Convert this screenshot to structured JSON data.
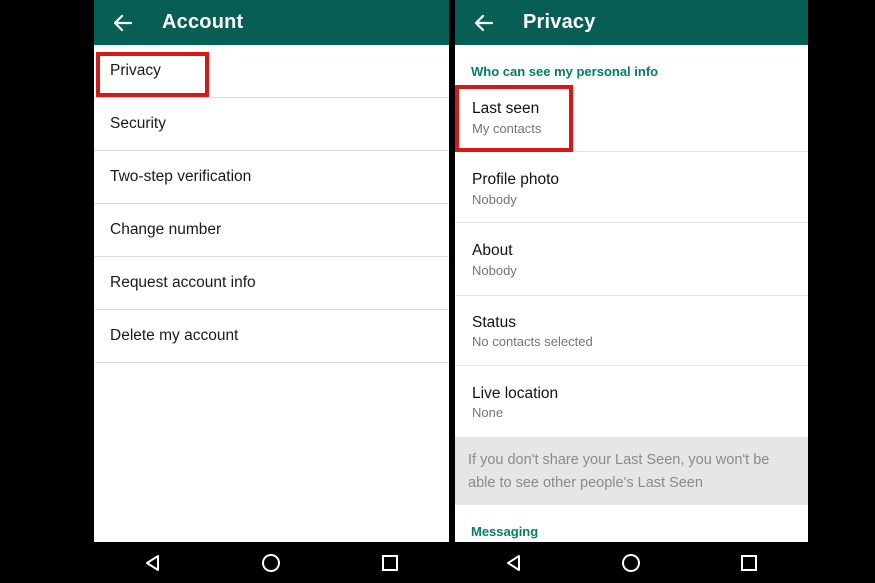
{
  "account_screen": {
    "title": "Account",
    "back_icon": "arrow-left-icon",
    "items": [
      {
        "label": "Privacy"
      },
      {
        "label": "Security"
      },
      {
        "label": "Two-step verification"
      },
      {
        "label": "Change number"
      },
      {
        "label": "Request account info"
      },
      {
        "label": "Delete my account"
      }
    ]
  },
  "privacy_screen": {
    "title": "Privacy",
    "back_icon": "arrow-left-icon",
    "section_personal": "Who can see my personal info",
    "settings": [
      {
        "label": "Last seen",
        "value": "My contacts"
      },
      {
        "label": "Profile photo",
        "value": "Nobody"
      },
      {
        "label": "About",
        "value": "Nobody"
      },
      {
        "label": "Status",
        "value": "No contacts selected"
      },
      {
        "label": "Live location",
        "value": "None"
      }
    ],
    "info_text": "If you don't share your Last Seen, you won't be able to see other people's Last Seen",
    "section_messaging": "Messaging"
  },
  "navbar": {
    "icons": [
      "back-triangle-icon",
      "home-circle-icon",
      "recents-square-icon"
    ]
  },
  "colors": {
    "appbar": "#075e54",
    "accent_text": "#0a7a6a",
    "highlight": "#d21a1a",
    "info_box": "#e6e6e6"
  }
}
